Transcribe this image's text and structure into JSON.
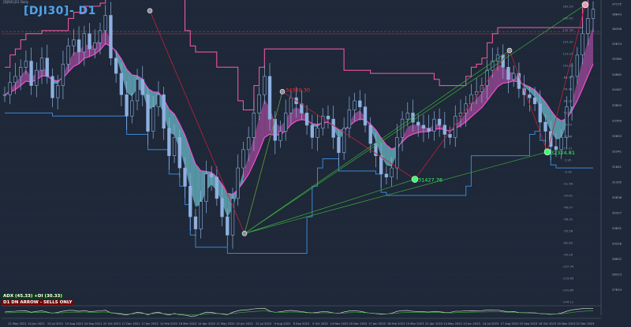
{
  "header": {
    "symbol_line": "[DJI30],D1 Daily",
    "title": "[DJI30]- D1"
  },
  "status": {
    "adx_line": "ADX (45.33)  +DI (30.33)",
    "direction_line": "D1  DN ARROW - SELLS ONLY"
  },
  "colors": {
    "background": "#1e2838",
    "grid": "#2c3a50",
    "candle": "#8fb0e0",
    "ribbon_bull": "#6ab8c8",
    "ribbon_bear": "#a04a9a",
    "ema_line": "#ff4fd8",
    "upper_channel": "#ff5aa8",
    "lower_channel": "#3a86d8",
    "trend_lines": "#3fae3f",
    "zigzag": "#c0203a",
    "label_green": "#3aff6a",
    "label_red": "#ff3030"
  },
  "chart_data": {
    "type": "candlestick",
    "title": "[DJI30]- D1",
    "symbol": "DJI30",
    "timeframe": "D1",
    "x_ticks": [
      "21 May 2021",
      "14 Jun 2021",
      "13 Jul 2021",
      "10 Aug 2021",
      "24 Sep 2021",
      "22 Oct 2021",
      "17 Dec 2021",
      "17 Jan 2022",
      "14 Feb 2022",
      "18 Mar 2022",
      "14 Apr 2022",
      "11 May 2022",
      "10 Jun 2022",
      "12 Jul 2022",
      "9 Aug 2022",
      "8 Sep 2022",
      "5 Oct 2022",
      "14 Nov 2022",
      "20 Dec 2022",
      "17 Jan 2023",
      "16 Feb 2023",
      "15 Mar 2023",
      "12 Apr 2023",
      "14 May 2023",
      "13 Jun 2023",
      "14 Jul 2023",
      "17 Aug 2023",
      "15 Sep 2023",
      "18 Oct 2023",
      "20 Nov 2023",
      "21 Dec 2023"
    ],
    "price_axis_ticks": [
      "37175",
      "36843",
      "36358",
      "35874",
      "35380",
      "34862",
      "34367",
      "33853",
      "33349",
      "32853",
      "32341",
      "31841",
      "31335",
      "30838",
      "30327",
      "29831",
      "29318",
      "28822",
      "28313",
      "27814"
    ],
    "secondary_axis_ticks": [
      "163.29",
      "150.05",
      "137.76",
      "125.50",
      "113.25",
      "101.00",
      "88.74",
      "76.48",
      "64.23",
      "51.97",
      "39.72",
      "27.46",
      "15.21",
      "2.95",
      "-9.30",
      "-21.56",
      "-33.81",
      "-46.07",
      "-58.32",
      "-70.58",
      "-82.83",
      "-95.09",
      "-107.34",
      "-119.60",
      "-131.85",
      "-144.11"
    ],
    "price_range": [
      27800,
      37200
    ],
    "level_labels": [
      "34380.30",
      "31427.76",
      "32324.81"
    ],
    "swing_markers": [
      {
        "date": "Jan 2022",
        "value": 36950,
        "marker": "grey"
      },
      {
        "date": "Jun 2022",
        "value": 29650,
        "marker": "grey"
      },
      {
        "date": "Aug 2022",
        "value": 34300,
        "marker": "grey"
      },
      {
        "date": "Mar 2023",
        "value": 31427.76,
        "marker": "green"
      },
      {
        "date": "Aug 2023",
        "value": 35650,
        "marker": "grey"
      },
      {
        "date": "Oct 2023",
        "value": 32324.81,
        "marker": "green"
      },
      {
        "date": "Dec 2023",
        "value": 37150,
        "marker": "red"
      }
    ],
    "series": [
      {
        "name": "Close",
        "values": [
          34200,
          34600,
          34800,
          35100,
          35300,
          34500,
          35000,
          35400,
          34800,
          34100,
          34500,
          35200,
          35800,
          36000,
          35600,
          36200,
          35700,
          35900,
          36300,
          36800,
          35400,
          34900,
          34200,
          33500,
          34000,
          34700,
          34200,
          33000,
          33800,
          34200,
          33100,
          32200,
          32800,
          31800,
          31200,
          30200,
          29800,
          30700,
          31600,
          31500,
          30800,
          30200,
          29600,
          30800,
          31800,
          32400,
          32800,
          33600,
          34200,
          34800,
          33400,
          32700,
          33000,
          33600,
          34100,
          33900,
          33600,
          33200,
          32800,
          33100,
          33500,
          33400,
          32800,
          32300,
          33100,
          33700,
          34000,
          33800,
          33200,
          32600,
          32200,
          31600,
          31500,
          31800,
          32800,
          33400,
          33600,
          33300,
          33200,
          33100,
          33000,
          33400,
          33200,
          32900,
          32800,
          33500,
          33600,
          33900,
          34200,
          34300,
          34500,
          35000,
          35300,
          35500,
          35100,
          34700,
          34900,
          34400,
          34200,
          34100,
          33900,
          33300,
          33000,
          32500,
          32400,
          32800,
          33800,
          34800,
          35500,
          36200,
          36700,
          37000
        ]
      }
    ]
  }
}
